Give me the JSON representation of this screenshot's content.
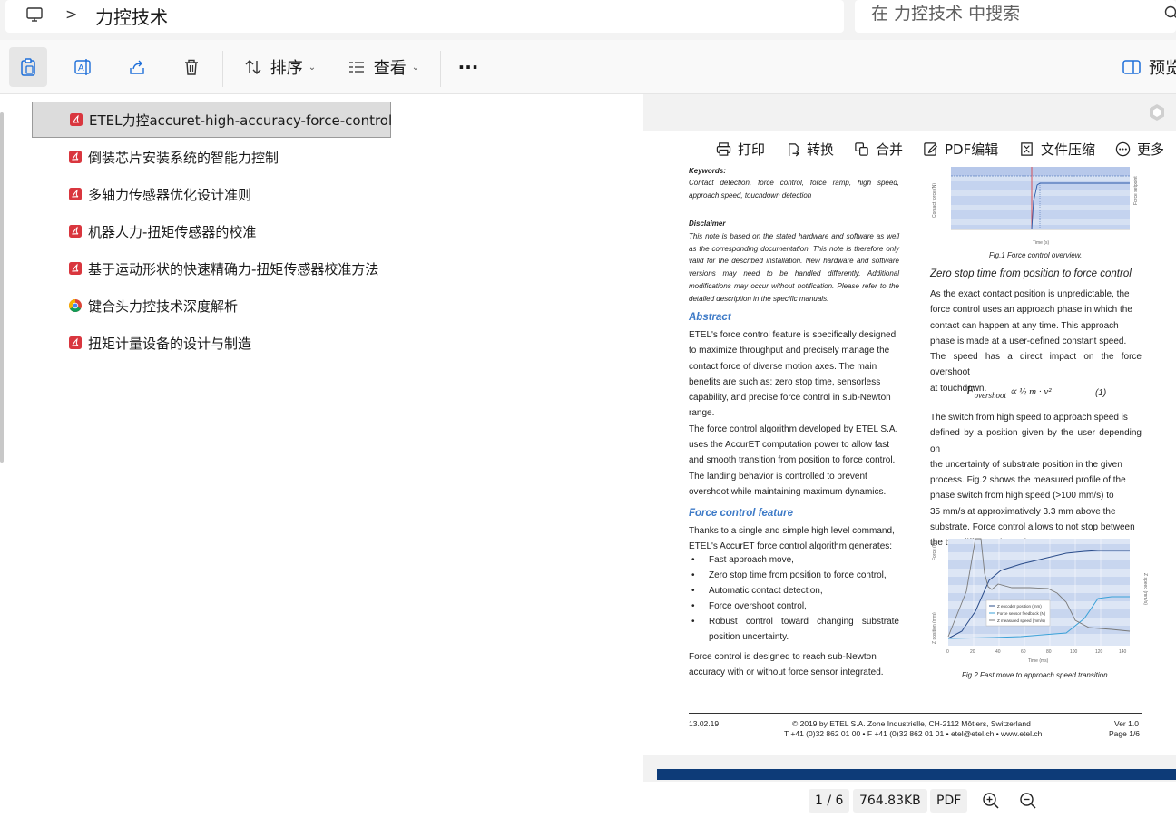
{
  "address_bar": {
    "breadcrumb_separator": ">",
    "current_folder": "力控技术",
    "search_placeholder": "在 力控技术 中搜索"
  },
  "toolbar": {
    "sort_label": "排序",
    "view_label": "查看",
    "more_label": "···",
    "preview_label": "预览"
  },
  "files": [
    {
      "name": "ETEL力控accuret-high-accuracy-force-control",
      "type": "pdf",
      "selected": true
    },
    {
      "name": "倒装芯片安装系统的智能力控制",
      "type": "pdf",
      "selected": false
    },
    {
      "name": "多轴力传感器优化设计准则",
      "type": "pdf",
      "selected": false
    },
    {
      "name": "机器人力-扭矩传感器的校准",
      "type": "pdf",
      "selected": false
    },
    {
      "name": "基于运动形状的快速精确力-扭矩传感器校准方法",
      "type": "pdf",
      "selected": false
    },
    {
      "name": "键合头力控技术深度解析",
      "type": "chrome",
      "selected": false
    },
    {
      "name": "扭矩计量设备的设计与制造",
      "type": "pdf",
      "selected": false
    }
  ],
  "pdf_toolbar": {
    "print": "打印",
    "convert": "转换",
    "merge": "合并",
    "edit": "PDF编辑",
    "compress": "文件压缩",
    "more": "更多"
  },
  "document": {
    "keywords_title": "Keywords:",
    "keywords_text": [
      "Contact detection, force control, force ramp, high speed,",
      "approach speed, touchdown detection"
    ],
    "disclaimer_title": "Disclaimer",
    "disclaimer_text": [
      "This note is based on the stated hardware and software as well",
      "as the corresponding documentation. This note is therefore only",
      "valid for the described installation. New hardware and software",
      "versions may need to be handled differently. Additional",
      "modifications may occur without notification. Please refer to the",
      "detailed description in the specific manuals."
    ],
    "abstract_title": "Abstract",
    "abstract_text": [
      "ETEL's force control feature is specifically designed",
      "to maximize throughput and precisely manage the",
      "contact force of diverse motion axes. The main",
      "benefits are such as: zero stop time, sensorless",
      "capability, and precise force control in sub-Newton",
      "range.",
      "The force control algorithm developed by ETEL S.A.",
      "uses the AccurET computation power to allow fast",
      "and smooth transition from position to force control.",
      "The landing behavior is controlled to prevent",
      "overshoot while maintaining maximum dynamics."
    ],
    "feature_title": "Force control feature",
    "feature_intro": [
      "Thanks to a single and simple high level command,",
      "ETEL's AccurET force control algorithm generates:"
    ],
    "bullets": [
      "Fast approach move,",
      "Zero stop time from position to force control,",
      "Automatic contact detection,",
      "Force overshoot control,",
      "Robust control toward changing substrate",
      "position uncertainty."
    ],
    "feature_outro": [
      "Force control is designed to reach sub-Newton",
      "accuracy with or without force sensor integrated."
    ],
    "fig1_caption": "Fig.1 Force control overview.",
    "fig1_xlabel": "Time (s)",
    "fig1_ylabel": "Contact force (N)",
    "fig1_rlabel": "Force setpoint",
    "section2_title": "Zero stop time from position to force control",
    "section2_text": [
      "As the exact contact position is unpredictable, the",
      "force control uses an approach phase in which the",
      "contact can happen at any time. This approach",
      "phase is made at a user-defined constant speed.",
      "The speed has a direct impact on the force overshoot",
      "at touchdown."
    ],
    "formula_lhs": "F",
    "formula_sub": "overshoot",
    "formula_rhs": "∝ ½ m · v²",
    "formula_num": "(1)",
    "section2_text2": [
      "The switch from high speed to approach speed is",
      "defined by a position given by the user depending on",
      "the uncertainty of substrate position in the given",
      "process. Fig.2 shows the measured profile of the",
      "phase switch from high speed (>100 mm/s) to",
      "35 mm/s at approximatively 3.3 mm above the",
      "substrate. Force control allows to not stop between",
      "the two different dynamic segments."
    ],
    "fig2_caption": "Fig.2 Fast move to approach speed transition.",
    "fig2_xlabel": "Time (ms)",
    "fig2_ylabel_left": "Z position (mm)",
    "fig2_ylabel_force": "Force (N)",
    "fig2_ylabel_right": "Z speed (mm/s)",
    "fig2_legend": [
      "Z encoder position (mm)",
      "Force sensor feedback (N)",
      "Z measured speed (mm/s)"
    ],
    "footer_date": "13.02.19",
    "footer_company_line1": "© 2019 by ETEL S.A. Zone Industrielle, CH-2112 Môtiers, Switzerland",
    "footer_company_line2": "T +41 (0)32 862 01 00 • F +41 (0)32 862 01 01 • etel@etel.ch • www.etel.ch",
    "footer_version": "Ver 1.0",
    "footer_page": "Page 1/6"
  },
  "status": {
    "page": "1 / 6",
    "size": "764.83KB",
    "type": "PDF"
  },
  "colors": {
    "accent_blue": "#3d7ac7",
    "pdf_red": "#d9363e",
    "selection_bg": "#dcdcdc",
    "footer_band": "#0d3b78"
  }
}
